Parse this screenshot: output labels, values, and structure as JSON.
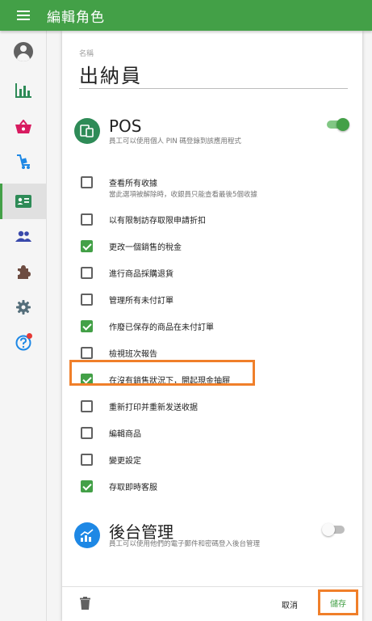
{
  "header": {
    "title": "編輯角色"
  },
  "sidebar": {
    "items": [
      "account-icon",
      "chart-icon",
      "basket-icon",
      "cart-icon",
      "badge-icon",
      "people-icon",
      "puzzle-icon",
      "gear-icon",
      "help-icon"
    ],
    "active": "badge-icon"
  },
  "role": {
    "name_label": "名稱",
    "name": "出納員"
  },
  "pos": {
    "title": "POS",
    "description": "員工可以使用個人 PIN 碼登錄到該應用程式",
    "enabled": true,
    "permissions": [
      {
        "label": "查看所有收據",
        "sub": "當此選項被解除時，收銀員只能查看最後5個收據",
        "checked": false
      },
      {
        "label": "以有限制訪存取限申請折扣",
        "checked": false
      },
      {
        "label": "更改一個銷售的稅金",
        "checked": true
      },
      {
        "label": "進行商品採購退貨",
        "checked": false
      },
      {
        "label": "管理所有未付訂單",
        "checked": false
      },
      {
        "label": "作廢已保存的商品在未付訂單",
        "checked": true
      },
      {
        "label": "檢視班次報告",
        "checked": false
      },
      {
        "label": "在沒有銷售狀況下，開起現金抽屜",
        "checked": true
      },
      {
        "label": "重新打印并重新发送收据",
        "checked": false
      },
      {
        "label": "編輯商品",
        "checked": false
      },
      {
        "label": "變更設定",
        "checked": false
      },
      {
        "label": "存取即時客服",
        "checked": true
      }
    ]
  },
  "backoffice": {
    "title": "後台管理",
    "description": "員工可以使用他們的電子郵件和密碼登入後台管理",
    "enabled": false
  },
  "footer": {
    "cancel_label": "取消",
    "save_label": "儲存"
  },
  "colors": {
    "primary": "#43a047",
    "highlight": "#f07f2a",
    "pos_icon_bg": "#2e8b57",
    "backoffice_icon_bg": "#1e88e5"
  }
}
